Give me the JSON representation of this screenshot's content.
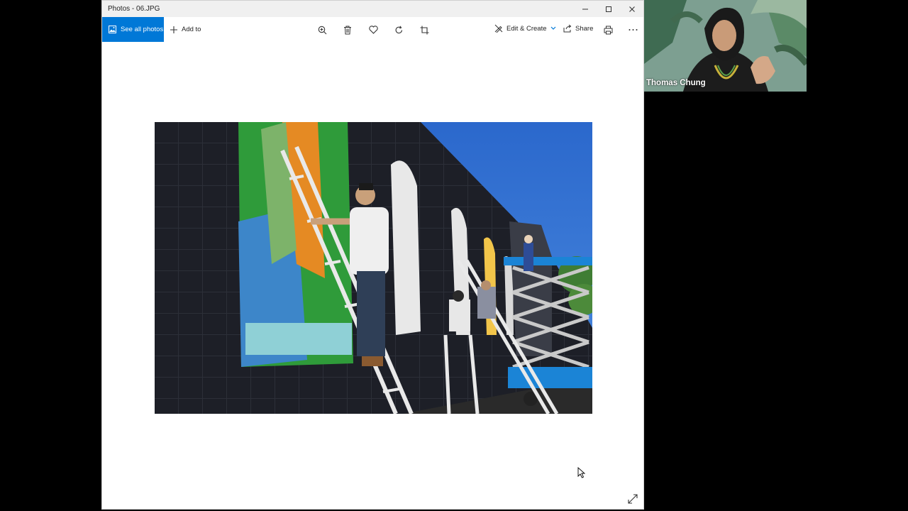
{
  "window": {
    "title": "Photos - 06.JPG"
  },
  "toolbar": {
    "see_all_label": "See all photos",
    "add_to_label": "Add to",
    "edit_create_label": "Edit & Create",
    "share_label": "Share"
  },
  "icons": {
    "zoom": "zoom-icon",
    "delete": "trash-icon",
    "favorite": "heart-icon",
    "rotate": "rotate-icon",
    "crop": "crop-icon",
    "print": "print-icon",
    "more": "more-icon",
    "expand": "expand-icon"
  },
  "participant": {
    "name": "Thomas Chung"
  },
  "colors": {
    "accent": "#0078d7",
    "titlebar": "#f0f0f0",
    "sky": "#2f6fd1"
  }
}
